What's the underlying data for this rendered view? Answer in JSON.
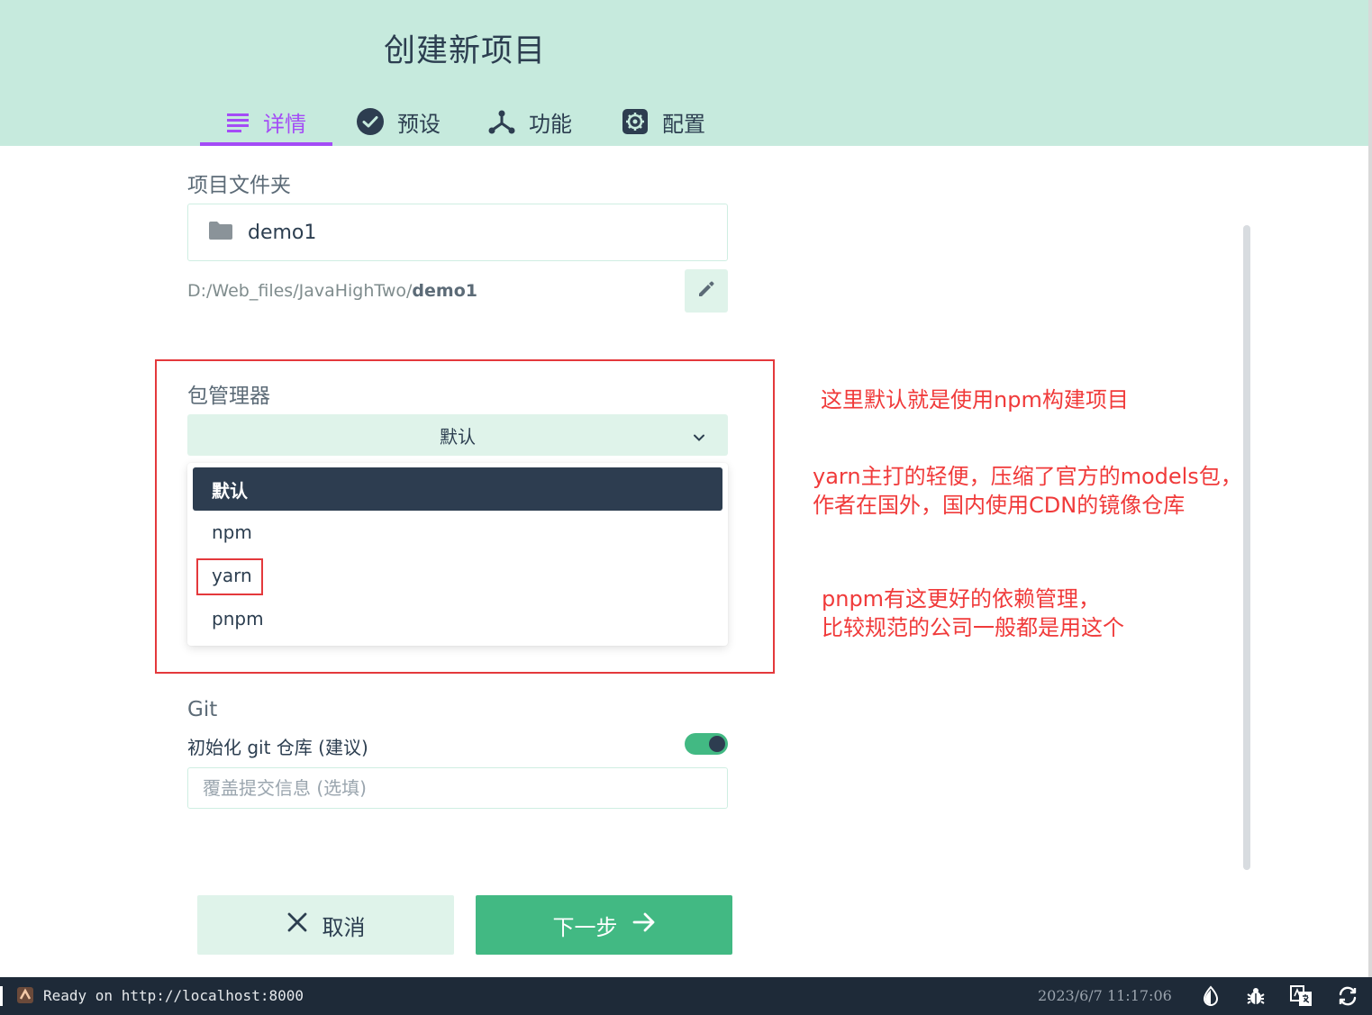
{
  "header": {
    "title": "创建新项目",
    "tabs": [
      {
        "label": "详情",
        "icon": "details-list-icon",
        "active": true
      },
      {
        "label": "预设",
        "icon": "check-circle-icon",
        "active": false
      },
      {
        "label": "功能",
        "icon": "features-branch-icon",
        "active": false
      },
      {
        "label": "配置",
        "icon": "settings-gear-icon",
        "active": false
      }
    ]
  },
  "project_folder": {
    "label": "项目文件夹",
    "folder_icon": "folder-icon",
    "value": "demo1",
    "path_prefix": "D:/Web_files/JavaHighTwo/",
    "path_bold": "demo1",
    "edit_icon": "pencil-icon"
  },
  "package_manager": {
    "label": "包管理器",
    "selected": "默认",
    "options": [
      "默认",
      "npm",
      "yarn",
      "pnpm"
    ]
  },
  "annotations": {
    "note1": "这里默认就是使用npm构建项目",
    "note2_line1": "yarn主打的轻便，压缩了官方的models包，",
    "note2_line2": "作者在国外，国内使用CDN的镜像仓库",
    "note3_line1": "pnpm有这更好的依赖管理，",
    "note3_line2": "比较规范的公司一般都是用这个"
  },
  "git": {
    "label": "Git",
    "init_label": "初始化 git 仓库 (建议)",
    "init_enabled": true,
    "commit_placeholder": "覆盖提交信息 (选填)",
    "commit_value": ""
  },
  "buttons": {
    "cancel": "取消",
    "next": "下一步"
  },
  "status_bar": {
    "text": "Ready on http://localhost:8000",
    "datetime": "2023/6/7 11:17:06",
    "icons": [
      "theme-drop-icon",
      "bug-icon",
      "translate-icon",
      "refresh-icon"
    ]
  },
  "colors": {
    "header_bg": "#c6eadd",
    "accent_purple": "#a44cf6",
    "primary_green": "#42b983",
    "dark": "#2d3d50",
    "annotation_red": "#e4393c"
  }
}
